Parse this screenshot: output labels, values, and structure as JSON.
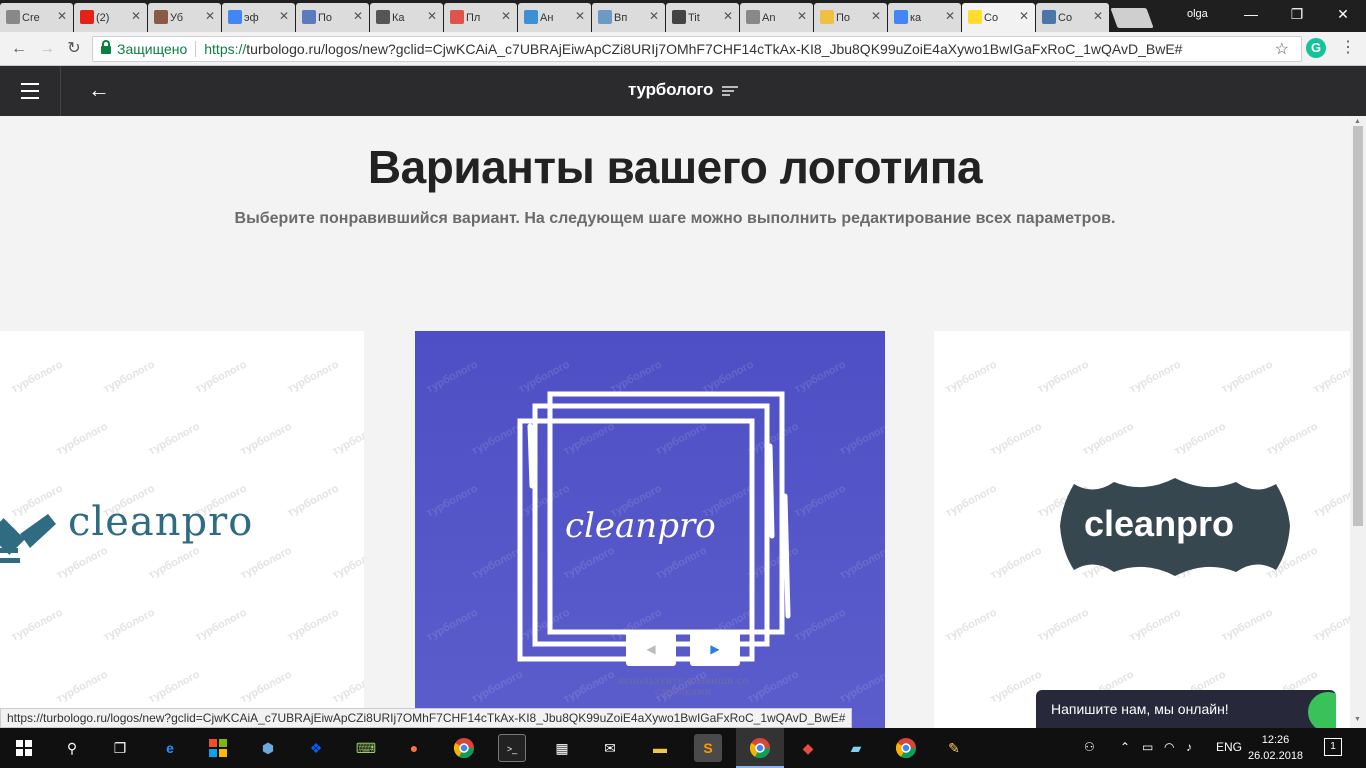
{
  "browser": {
    "tabs": [
      {
        "title": "Cre",
        "icon": "doc-icon",
        "color": "#888"
      },
      {
        "title": "(2)",
        "icon": "youtube-icon",
        "color": "#e62117"
      },
      {
        "title": "Уб",
        "icon": "site-icon",
        "color": "#8a5a44"
      },
      {
        "title": "эф",
        "icon": "google-icon",
        "color": "#4285f4"
      },
      {
        "title": "По",
        "icon": "globe-icon",
        "color": "#5a7bbd"
      },
      {
        "title": "Ка",
        "icon": "t-icon",
        "color": "#555"
      },
      {
        "title": "Пл",
        "icon": "sa-icon",
        "color": "#e0534a"
      },
      {
        "title": "Ан",
        "icon": "circle-icon",
        "color": "#3d8fd6"
      },
      {
        "title": "Вп",
        "icon": "n-icon",
        "color": "#6b9ac4"
      },
      {
        "title": "Tit",
        "icon": "grid-icon",
        "color": "#444"
      },
      {
        "title": "An",
        "icon": "doc-icon",
        "color": "#888"
      },
      {
        "title": "По",
        "icon": "jq-icon",
        "color": "#f0c040"
      },
      {
        "title": "ка",
        "icon": "google-icon",
        "color": "#4285f4"
      },
      {
        "title": "Co",
        "icon": "turbologo-icon",
        "color": "#ffdd2d",
        "active": true
      },
      {
        "title": "Co",
        "icon": "vk-icon",
        "color": "#4a76a8"
      }
    ],
    "user": "olga",
    "secure_label": "Защищено",
    "url_proto": "https://",
    "url_rest": "turbologo.ru/logos/new?gclid=CjwKCAiA_c7UBRAjEiwApCZi8URIj7OMhF7CHF14cTkAx-KI8_Jbu8QK99uZoiE4aXywo1BwIGaFxRoC_1wQAvD_BwE#",
    "extension_label": "G",
    "status_url": "https://turbologo.ru/logos/new?gclid=CjwKCAiA_c7UBRAjEiwApCZi8URIj7OMhF7CHF14cTkAx-KI8_Jbu8QK99uZoiE4aXywo1BwIGaFxRoC_1wQAvD_BwE#"
  },
  "site": {
    "brand": "турболого",
    "heading": "Варианты вашего логотипа",
    "subheading": "Выберите понравившийся вариант. На следующем шаге можно выполнить редактирование всех параметров.",
    "watermark": "турболого",
    "logos": {
      "left": "cleanpro",
      "middle": "cleanpro",
      "right": "cleanpro"
    },
    "colors": {
      "left_logo": "#2f6c82",
      "middle_bg": "#4e4fc4",
      "right_badge": "#37474f"
    },
    "prev_arrow": "◀",
    "next_arrow": "▶",
    "hint_line1": "используйте клавиши со",
    "hint_line2": "стрелками",
    "chat_label": "Напишите нам, мы онлайн!"
  },
  "taskbar": {
    "language": "ENG",
    "time": "12:26",
    "date": "26.02.2018",
    "notifications": "1"
  }
}
